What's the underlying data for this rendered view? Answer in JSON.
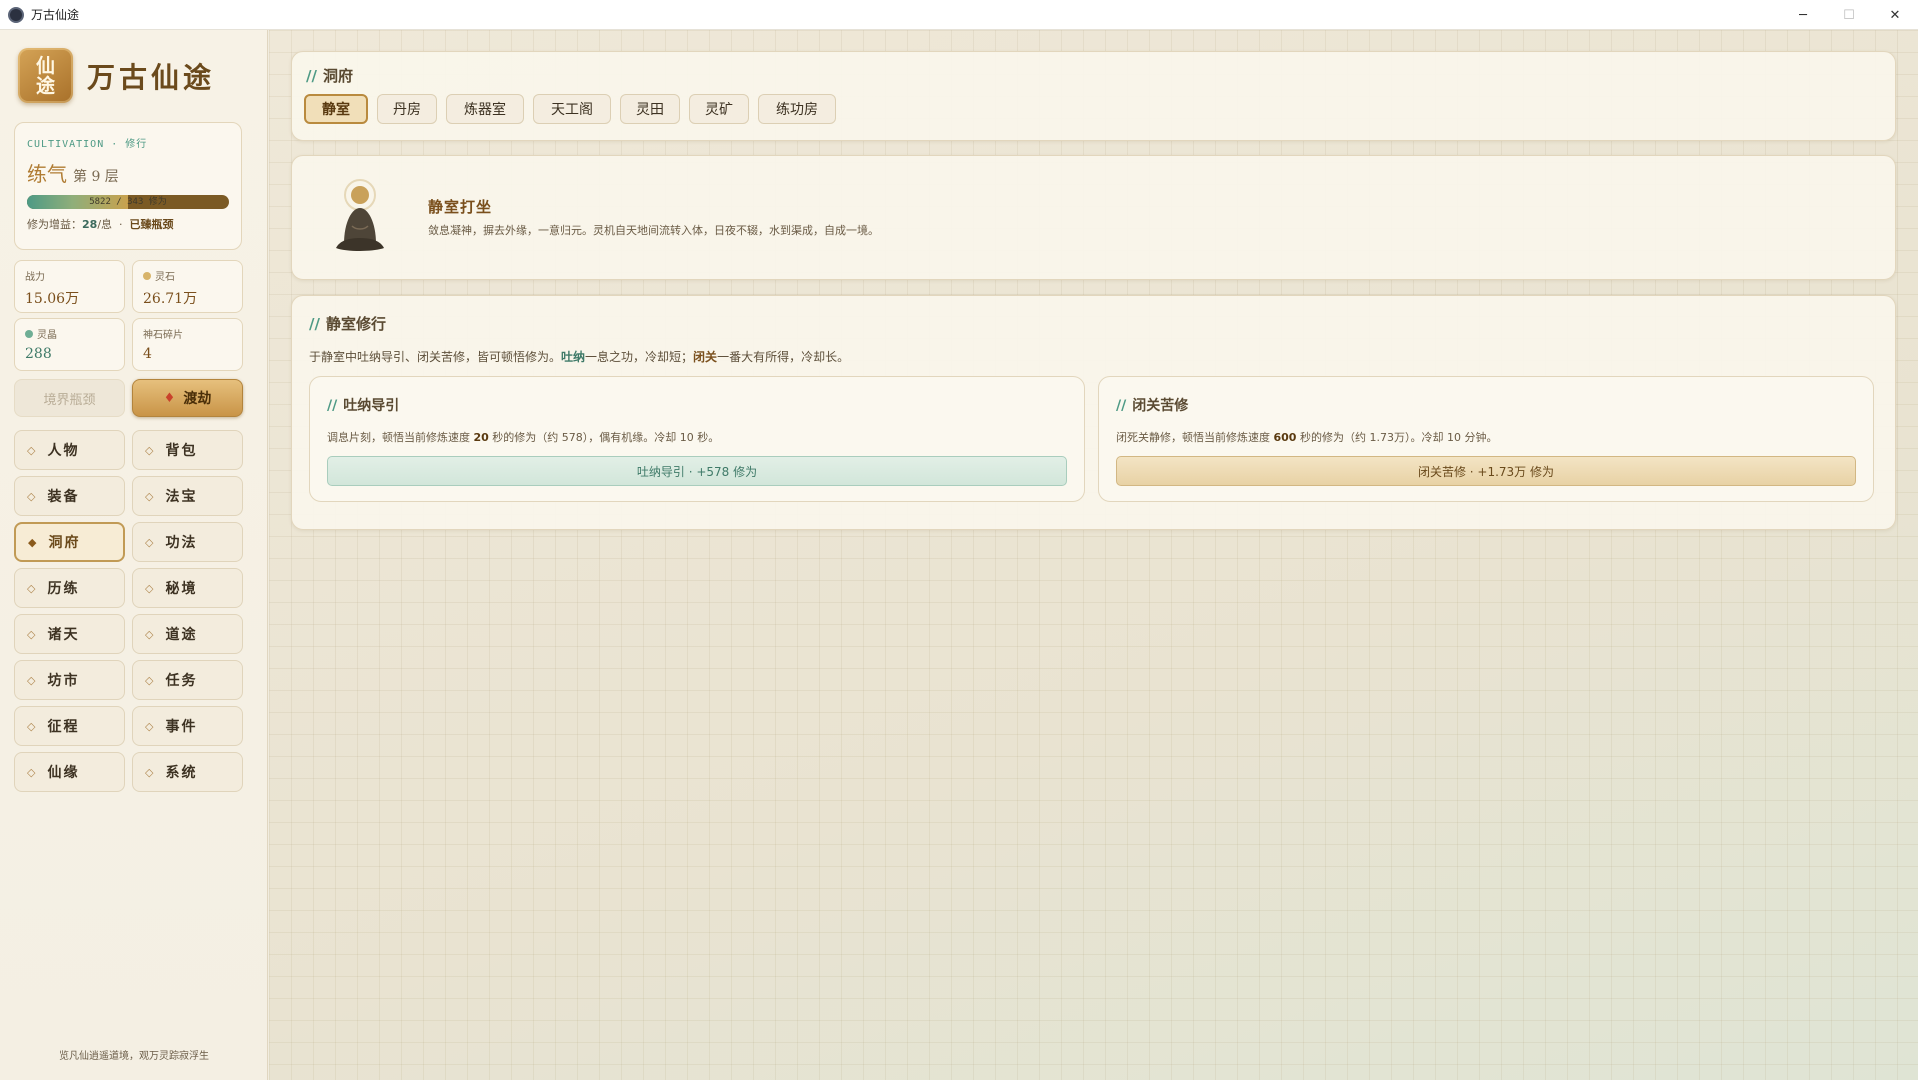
{
  "window": {
    "title": "万古仙途",
    "controls": {
      "minimize": "─",
      "maximize": "☐",
      "close": "✕"
    }
  },
  "brand": {
    "logo_line1": "仙",
    "logo_line2": "途",
    "title": "万古仙途"
  },
  "cultivation": {
    "eyebrow": "CULTIVATION · 修行",
    "realm": "练气",
    "level": "第 9 层",
    "progress_text": "5822 / 343 修为",
    "progress_fraction": 0.5,
    "rate_label": "修为增益：",
    "rate_value": "28",
    "rate_unit": "/息",
    "separator": "·",
    "status": "已臻瓶颈"
  },
  "stats": {
    "combat": {
      "label": "战力",
      "value": "15.06万"
    },
    "spirit_stones": {
      "label": "灵石",
      "value": "26.71万"
    },
    "spirit_crystal": {
      "label": "灵晶",
      "value": "288"
    },
    "god_shards": {
      "label": "神石碎片",
      "value": "4"
    }
  },
  "actions": {
    "bottleneck": "境界瓶颈",
    "tribulation": "渡劫"
  },
  "nav": [
    {
      "label": "人物",
      "name": "nav-character"
    },
    {
      "label": "背包",
      "name": "nav-backpack"
    },
    {
      "label": "装备",
      "name": "nav-equipment"
    },
    {
      "label": "法宝",
      "name": "nav-treasure"
    },
    {
      "label": "洞府",
      "name": "nav-cave",
      "active": true
    },
    {
      "label": "功法",
      "name": "nav-technique"
    },
    {
      "label": "历练",
      "name": "nav-training"
    },
    {
      "label": "秘境",
      "name": "nav-secret-realm"
    },
    {
      "label": "诸天",
      "name": "nav-heavens"
    },
    {
      "label": "道途",
      "name": "nav-dao-path"
    },
    {
      "label": "坊市",
      "name": "nav-market"
    },
    {
      "label": "任务",
      "name": "nav-tasks"
    },
    {
      "label": "征程",
      "name": "nav-journey"
    },
    {
      "label": "事件",
      "name": "nav-events"
    },
    {
      "label": "仙缘",
      "name": "nav-fate"
    },
    {
      "label": "系统",
      "name": "nav-system"
    }
  ],
  "footer": "览凡仙逍遥道境，观万灵踪寂浮生",
  "cave": {
    "heading": "洞府",
    "tabs": [
      "静室",
      "丹房",
      "炼器室",
      "天工阁",
      "灵田",
      "灵矿",
      "练功房"
    ],
    "active_tab": 0
  },
  "room": {
    "title": "静室打坐",
    "description": "敛息凝神，摒去外缘，一意归元。灵机自天地间流转入体，日夜不辍，水到渠成，自成一境。"
  },
  "practice": {
    "heading": "静室修行",
    "desc_prefix": "于静室中吐纳导引、闭关苦修，皆可顿悟修为。",
    "desc_breath": "吐纳",
    "desc_mid": "一息之功，冷却短；",
    "desc_seclusion": "闭关",
    "desc_suffix": "一番大有所得，冷却长。",
    "breathing": {
      "heading": "吐纳导引",
      "desc_prefix": "调息片刻，顿悟当前修炼速度 ",
      "desc_value": "20",
      "desc_suffix": " 秒的修为（约 578），偶有机缘。冷却 10 秒。",
      "button": "吐纳导引 · +578 修为"
    },
    "seclusion": {
      "heading": "闭关苦修",
      "desc_prefix": "闭死关静修，顿悟当前修炼速度 ",
      "desc_value": "600",
      "desc_suffix": " 秒的修为（约 1.73万）。冷却 10 分钟。",
      "button": "闭关苦修 · +1.73万 修为"
    }
  },
  "colors": {
    "accent_green": "#4e9a85",
    "accent_gold": "#c99447",
    "brown": "#7a4f1c",
    "danger_flame": "#c9422b"
  }
}
